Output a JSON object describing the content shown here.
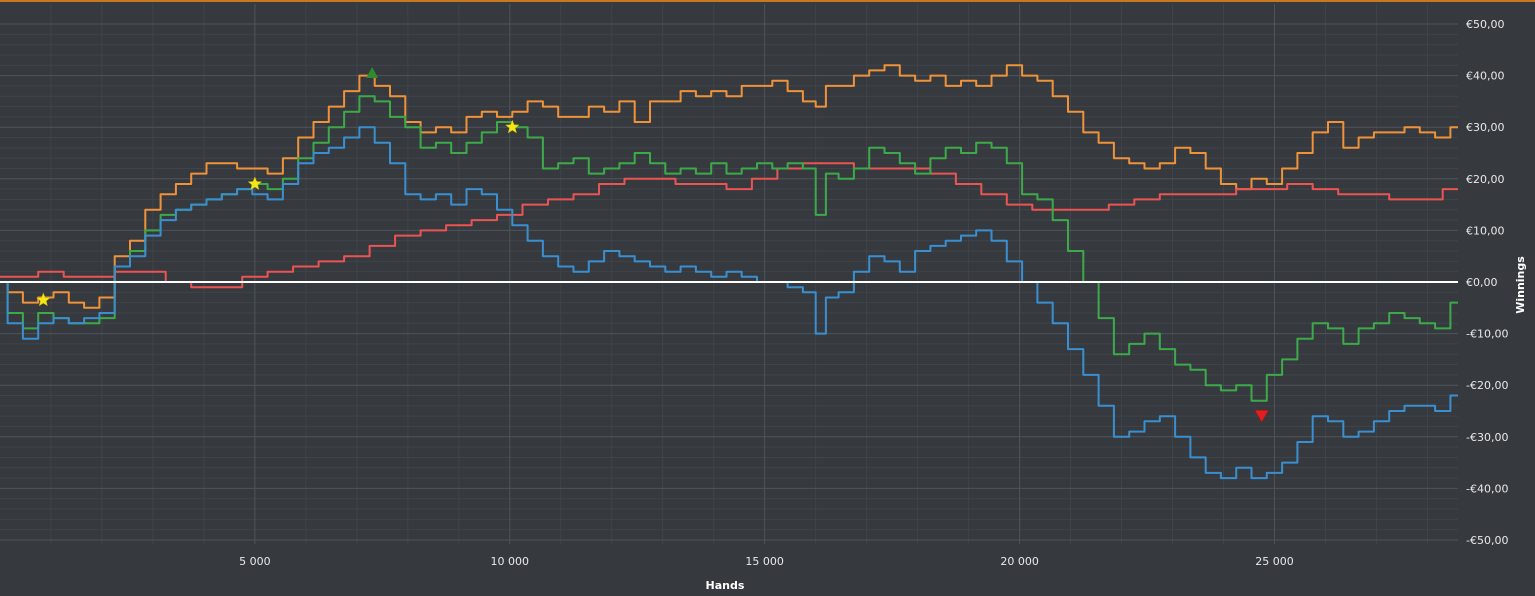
{
  "chart_data": {
    "type": "line",
    "xlabel": "Hands",
    "ylabel": "Winnings",
    "xlim": [
      0,
      28600
    ],
    "ylim": [
      -50,
      50
    ],
    "x_ticks": [
      {
        "value": 5000,
        "label": "5 000"
      },
      {
        "value": 10000,
        "label": "10 000"
      },
      {
        "value": 15000,
        "label": "15 000"
      },
      {
        "value": 20000,
        "label": "20 000"
      },
      {
        "value": 25000,
        "label": "25 000"
      }
    ],
    "y_ticks": [
      {
        "value": 50,
        "label": "€50,00"
      },
      {
        "value": 40,
        "label": "€40,00"
      },
      {
        "value": 30,
        "label": "€30,00"
      },
      {
        "value": 20,
        "label": "€20,00"
      },
      {
        "value": 10,
        "label": "€10,00"
      },
      {
        "value": 0,
        "label": "€0,00"
      },
      {
        "value": -10,
        "label": "-€10,00"
      },
      {
        "value": -20,
        "label": "-€20,00"
      },
      {
        "value": -30,
        "label": "-€30,00"
      },
      {
        "value": -40,
        "label": "-€40,00"
      },
      {
        "value": -50,
        "label": "-€50,00"
      }
    ],
    "grid": true,
    "zero_line_color": "#ffffff",
    "series": [
      {
        "color": "#f0923a",
        "x": [
          0,
          300,
          600,
          900,
          1200,
          1500,
          1800,
          2100,
          2400,
          2700,
          3000,
          3300,
          3600,
          3900,
          4200,
          4500,
          4800,
          5100,
          5400,
          5700,
          6000,
          6300,
          6600,
          6900,
          7200,
          7500,
          7800,
          8100,
          8400,
          8700,
          9000,
          9300,
          9600,
          9900,
          10200,
          10500,
          10800,
          11100,
          11400,
          11700,
          12000,
          12300,
          12600,
          12900,
          13200,
          13500,
          13800,
          14100,
          14400,
          14700,
          15000,
          15300,
          15600,
          15900,
          16100,
          16300,
          16600,
          16900,
          17200,
          17500,
          17800,
          18100,
          18400,
          18700,
          19000,
          19300,
          19600,
          19900,
          20200,
          20500,
          20800,
          21100,
          21400,
          21700,
          22000,
          22300,
          22600,
          22900,
          23200,
          23500,
          23800,
          24100,
          24400,
          24700,
          25000,
          25300,
          25600,
          25900,
          26200,
          26500,
          26800,
          27100,
          27400,
          27700,
          28000,
          28300,
          28600
        ],
        "y": [
          0,
          -2,
          -4,
          -3,
          -2,
          -4,
          -5,
          -3,
          5,
          8,
          14,
          17,
          19,
          21,
          23,
          23,
          22,
          22,
          21,
          24,
          28,
          31,
          34,
          37,
          40,
          38,
          36,
          31,
          29,
          30,
          29,
          32,
          33,
          32,
          33,
          35,
          34,
          32,
          32,
          34,
          33,
          35,
          31,
          35,
          35,
          37,
          36,
          37,
          36,
          38,
          38,
          39,
          37,
          35,
          34,
          38,
          38,
          40,
          41,
          42,
          40,
          39,
          40,
          38,
          39,
          38,
          40,
          42,
          40,
          39,
          36,
          33,
          29,
          27,
          24,
          23,
          22,
          23,
          26,
          25,
          22,
          19,
          18,
          20,
          19,
          22,
          25,
          29,
          31,
          26,
          28,
          29,
          29,
          30,
          29,
          28,
          30
        ]
      },
      {
        "color": "#ec5454",
        "x": [
          0,
          500,
          1000,
          1500,
          2000,
          2500,
          3000,
          3500,
          4000,
          4500,
          5000,
          5500,
          6000,
          6500,
          7000,
          7500,
          8000,
          8500,
          9000,
          9500,
          10000,
          10500,
          11000,
          11500,
          12000,
          12500,
          13000,
          13500,
          14000,
          14500,
          15000,
          15500,
          16000,
          16500,
          17000,
          17500,
          18000,
          18500,
          19000,
          19500,
          20000,
          20500,
          21000,
          21500,
          22000,
          22500,
          23000,
          23500,
          24000,
          24500,
          25000,
          25500,
          26000,
          26500,
          27000,
          27500,
          28000,
          28600
        ],
        "y": [
          1,
          1,
          2,
          1,
          1,
          2,
          2,
          0,
          -1,
          -1,
          1,
          2,
          3,
          4,
          5,
          7,
          9,
          10,
          11,
          12,
          13,
          15,
          16,
          17,
          19,
          20,
          20,
          19,
          19,
          18,
          20,
          22,
          23,
          23,
          22,
          22,
          22,
          21,
          19,
          17,
          15,
          14,
          14,
          14,
          15,
          16,
          17,
          17,
          17,
          18,
          18,
          19,
          18,
          17,
          17,
          16,
          16,
          18
        ]
      },
      {
        "color": "#3daa4a",
        "x": [
          0,
          300,
          600,
          900,
          1200,
          1500,
          1800,
          2100,
          2400,
          2700,
          3000,
          3300,
          3600,
          3900,
          4200,
          4500,
          4800,
          5100,
          5400,
          5700,
          6000,
          6300,
          6600,
          6900,
          7200,
          7500,
          7800,
          8100,
          8400,
          8700,
          9000,
          9300,
          9600,
          9900,
          10200,
          10500,
          10800,
          11100,
          11400,
          11700,
          12000,
          12300,
          12600,
          12900,
          13200,
          13500,
          13800,
          14100,
          14400,
          14700,
          15000,
          15300,
          15600,
          15900,
          16100,
          16300,
          16600,
          16900,
          17200,
          17500,
          17800,
          18100,
          18400,
          18700,
          19000,
          19300,
          19600,
          19900,
          20200,
          20500,
          20800,
          21100,
          21400,
          21700,
          22000,
          22300,
          22600,
          22900,
          23200,
          23500,
          23800,
          24100,
          24400,
          24700,
          25000,
          25300,
          25600,
          25900,
          26200,
          26500,
          26800,
          27100,
          27400,
          27700,
          28000,
          28300,
          28600
        ],
        "y": [
          0,
          -6,
          -9,
          -6,
          -7,
          -8,
          -8,
          -7,
          3,
          6,
          10,
          13,
          14,
          15,
          16,
          17,
          18,
          19,
          18,
          20,
          24,
          27,
          30,
          33,
          36,
          35,
          32,
          30,
          26,
          27,
          25,
          27,
          29,
          31,
          30,
          28,
          22,
          23,
          24,
          21,
          22,
          23,
          25,
          23,
          21,
          22,
          21,
          23,
          21,
          22,
          23,
          22,
          23,
          22,
          13,
          21,
          20,
          22,
          26,
          25,
          23,
          21,
          24,
          26,
          25,
          27,
          26,
          23,
          17,
          16,
          12,
          6,
          0,
          -7,
          -14,
          -12,
          -10,
          -13,
          -16,
          -17,
          -20,
          -21,
          -20,
          -23,
          -18,
          -15,
          -11,
          -8,
          -9,
          -12,
          -9,
          -8,
          -6,
          -7,
          -8,
          -9,
          -4
        ]
      },
      {
        "color": "#3a8fd0",
        "x": [
          0,
          300,
          600,
          900,
          1200,
          1500,
          1800,
          2100,
          2400,
          2700,
          3000,
          3300,
          3600,
          3900,
          4200,
          4500,
          4800,
          5100,
          5400,
          5700,
          6000,
          6300,
          6600,
          6900,
          7200,
          7500,
          7800,
          8100,
          8400,
          8700,
          9000,
          9300,
          9600,
          9900,
          10200,
          10500,
          10800,
          11100,
          11400,
          11700,
          12000,
          12300,
          12600,
          12900,
          13200,
          13500,
          13800,
          14100,
          14400,
          14700,
          15000,
          15300,
          15600,
          15900,
          16100,
          16300,
          16600,
          16900,
          17200,
          17500,
          17800,
          18100,
          18400,
          18700,
          19000,
          19300,
          19600,
          19900,
          20200,
          20500,
          20800,
          21100,
          21400,
          21700,
          22000,
          22300,
          22600,
          22900,
          23200,
          23500,
          23800,
          24100,
          24400,
          24700,
          25000,
          25300,
          25600,
          25900,
          26200,
          26500,
          26800,
          27100,
          27400,
          27700,
          28000,
          28300,
          28600
        ],
        "y": [
          0,
          -8,
          -11,
          -8,
          -7,
          -8,
          -7,
          -6,
          3,
          5,
          9,
          12,
          14,
          15,
          16,
          17,
          18,
          17,
          16,
          19,
          23,
          25,
          26,
          28,
          30,
          27,
          23,
          17,
          16,
          17,
          15,
          18,
          17,
          14,
          11,
          8,
          5,
          3,
          2,
          4,
          6,
          5,
          4,
          3,
          2,
          3,
          2,
          1,
          2,
          1,
          0,
          0,
          -1,
          -2,
          -10,
          -3,
          -2,
          2,
          5,
          4,
          2,
          6,
          7,
          8,
          9,
          10,
          8,
          4,
          0,
          -4,
          -8,
          -13,
          -18,
          -24,
          -30,
          -29,
          -27,
          -26,
          -30,
          -34,
          -37,
          -38,
          -36,
          -38,
          -37,
          -35,
          -31,
          -26,
          -27,
          -30,
          -29,
          -27,
          -25,
          -24,
          -24,
          -25,
          -22
        ]
      }
    ],
    "markers": [
      {
        "type": "star",
        "color": "#f5e61b",
        "x": 850,
        "y": -3.5
      },
      {
        "type": "star",
        "color": "#f5e61b",
        "x": 5000,
        "y": 19
      },
      {
        "type": "star",
        "color": "#f5e61b",
        "x": 10050,
        "y": 30
      },
      {
        "type": "triangle-up",
        "color": "#2e8b2e",
        "x": 7300,
        "y": 40.5
      },
      {
        "type": "triangle-down",
        "color": "#e21f1f",
        "x": 24750,
        "y": -26
      }
    ]
  }
}
